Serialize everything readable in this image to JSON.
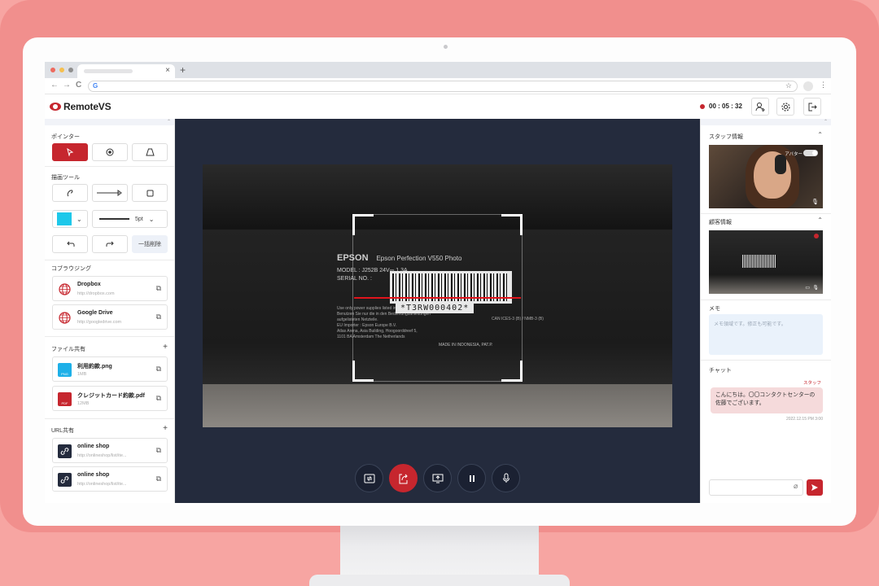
{
  "app": {
    "name": "RemoteVS",
    "timer": "00 : 05 : 32"
  },
  "browser": {
    "tab_close": "×",
    "tab_add": "+",
    "back": "←",
    "forward": "→",
    "reload": "C",
    "star": "☆",
    "menu": "⋮",
    "google_glyph": "G"
  },
  "left": {
    "pointer_title": "ポインター",
    "draw_title": "描画ツール",
    "color": "#1ec8ea",
    "line_width": "5pt",
    "clear_all": "一括削除",
    "cobrowse_title": "コブラウジング",
    "cobrowse": [
      {
        "name": "Dropbox",
        "url": "http://dropbox.com"
      },
      {
        "name": "Google Drive",
        "url": "http://googledrive.com"
      }
    ],
    "files_title": "ファイル共有",
    "files": [
      {
        "name": "利用約款.png",
        "size": "1MB",
        "badge": "PNG"
      },
      {
        "name": "クレジットカード約款.pdf",
        "size": "12MB",
        "badge": "PDF"
      }
    ],
    "urls_title": "URL共有",
    "urls": [
      {
        "name": "online shop",
        "url": "http://onlineshop/list/ite..."
      },
      {
        "name": "online shop",
        "url": "http://onlineshop/list/ite..."
      }
    ]
  },
  "video": {
    "brand": "EPSON",
    "model_name": "Epson Perfection V550 Photo",
    "model_line": "MODEL : J252B     24V⎓ 1.3A",
    "serial_label": "SERIAL NO. :",
    "serial": "*T3RW000402*",
    "fine_print": [
      "Use only power supplies listed in the instructions.",
      "Benutzen Sie nur die in den Bedienungsanleitungen",
      "aufgelisteten Netzteile.",
      "EU Importer : Epson Europe B.V.",
      "Atlas Arena, Asia Building, Hoogoorddreef 5,",
      "1101 BA Amsterdam The Netherlands"
    ],
    "made_in": "MADE IN INDONESIA, PAT.P.",
    "can_ices": "CAN ICES-3 (B) / NMB-3 (B)"
  },
  "right": {
    "staff_title": "スタッフ情報",
    "avatar_label": "アバター",
    "customer_title": "顧客情報",
    "memo_title": "メモ",
    "memo_placeholder": "メモ領域です。修正も可能です。",
    "chat_title": "チャット",
    "chat_sender": "スタッフ",
    "chat_message": "こんにちは。〇〇コンタクトセンターの佐藤でございます。",
    "chat_time": "2022.12.15 PM 3:00"
  },
  "colors": {
    "accent": "#c6262e",
    "video_bg": "#242b3d",
    "laser": "#e0141c"
  }
}
